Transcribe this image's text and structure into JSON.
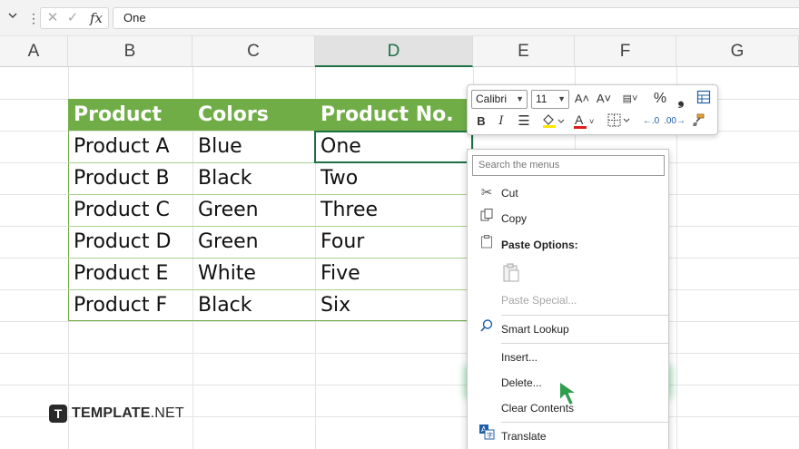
{
  "formula_bar": {
    "dropdown_icon": "chevron-down-icon",
    "more_icon": "vertical-dots-icon",
    "cancel_glyph": "✕",
    "enter_glyph": "✓",
    "fx_label": "fx",
    "value": "One"
  },
  "columns": [
    "A",
    "B",
    "C",
    "D",
    "E",
    "F",
    "G"
  ],
  "selected_column": "D",
  "table": {
    "headers": [
      "Product",
      "Colors",
      "Product No."
    ],
    "rows": [
      [
        "Product A",
        "Blue",
        "One"
      ],
      [
        "Product B",
        "Black",
        "Two"
      ],
      [
        "Product C",
        "Green",
        "Three"
      ],
      [
        "Product D",
        "Green",
        "Four"
      ],
      [
        "Product E",
        "White",
        "Five"
      ],
      [
        "Product F",
        "Black",
        "Six"
      ]
    ],
    "header_color": "#70ad47"
  },
  "mini_toolbar": {
    "font_name": "Calibri",
    "font_size": "11",
    "bold": "B",
    "italic": "I",
    "percent": "%",
    "comma": "❟",
    "font_color_letter": "A",
    "increase_font": "A˄",
    "decrease_font": "A˅",
    "decimal_inc": "←.0",
    "decimal_dec": ".00→"
  },
  "context_menu": {
    "search_placeholder": "Search the menus",
    "cut": "Cut",
    "copy": "Copy",
    "paste_options": "Paste Options:",
    "paste_special": "Paste Special...",
    "smart_lookup": "Smart Lookup",
    "insert": "Insert...",
    "delete": "Delete...",
    "clear_contents": "Clear Contents",
    "translate": "Translate"
  },
  "logo": {
    "mark": "T",
    "name": "TEMPLATE",
    "suffix": ".NET"
  },
  "colors": {
    "accent_green": "#1d7044",
    "table_green": "#70ad47",
    "cursor_green": "#2e9e4f"
  }
}
